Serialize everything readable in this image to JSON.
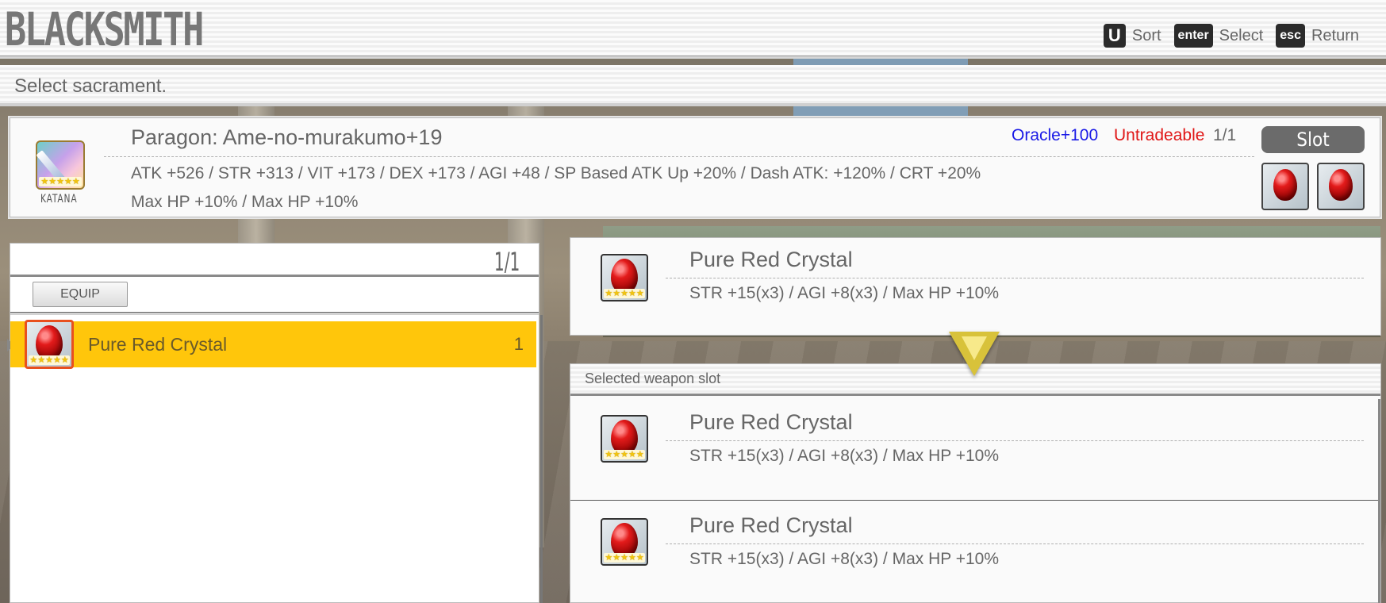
{
  "header": {
    "title": "BLACKSMITH",
    "hints": [
      {
        "key": "U",
        "label": "Sort"
      },
      {
        "key": "enter",
        "label": "Select"
      },
      {
        "key": "esc",
        "label": "Return"
      }
    ]
  },
  "instruction": "Select sacrament.",
  "weapon": {
    "name": "Paragon: Ame-no-murakumo+19",
    "type": "KATANA",
    "stars": 5,
    "oracle": "Oracle+100",
    "untradeable": "Untradeable",
    "count": "1/1",
    "stats_line1": "ATK +526  /  STR +313  /  VIT +173  /  DEX +173  /  AGI +48  /  SP Based ATK Up +20%  /  Dash ATK:  +120%  /  CRT  +20%",
    "stats_line2": "Max HP  +10%  /  Max HP  +10%",
    "slot_label": "Slot",
    "slots": [
      "red-crystal-icon",
      "red-crystal-icon"
    ]
  },
  "list": {
    "count": "1/1",
    "equip_label": "EQUIP",
    "items": [
      {
        "name": "Pure Red Crystal",
        "qty": "1",
        "stars": 5,
        "selected": true
      }
    ]
  },
  "preview": {
    "name": "Pure Red Crystal",
    "stats": "STR +15(x3)  /  AGI +8(x3)  /  Max HP  +10%"
  },
  "selected_slot": {
    "title": "Selected weapon slot",
    "slots": [
      {
        "name": "Pure Red Crystal",
        "stats": "STR +15(x3)  /  AGI +8(x3)  /  Max HP  +10%"
      },
      {
        "name": "Pure Red Crystal",
        "stats": "STR +15(x3)  /  AGI +8(x3)  /  Max HP  +10%"
      }
    ]
  },
  "colors": {
    "highlight": "#ffc60b",
    "oracle": "#1a1ae6",
    "untradeable": "#e01616",
    "gem": "#e31b1b"
  }
}
